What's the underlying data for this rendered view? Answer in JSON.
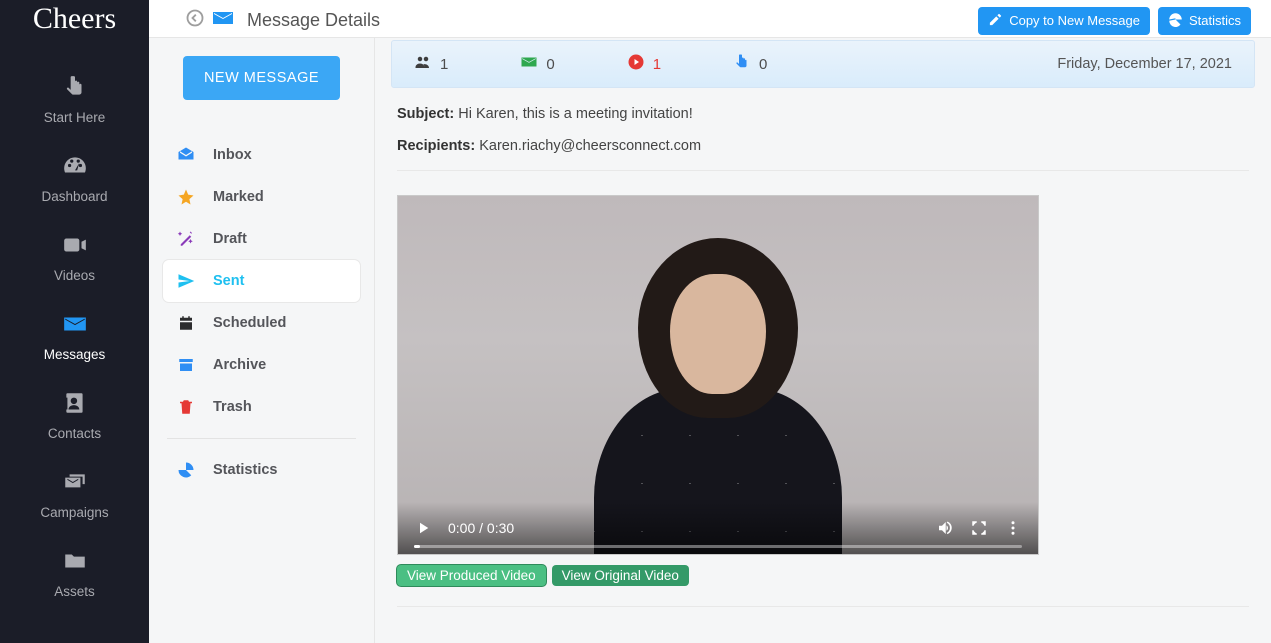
{
  "brand": "Cheers",
  "nav": {
    "items": [
      {
        "label": "Start Here"
      },
      {
        "label": "Dashboard"
      },
      {
        "label": "Videos"
      },
      {
        "label": "Messages"
      },
      {
        "label": "Contacts"
      },
      {
        "label": "Campaigns"
      },
      {
        "label": "Assets"
      }
    ]
  },
  "header": {
    "title": "Message Details",
    "copy_label": "Copy to New Message",
    "stats_label": "Statistics"
  },
  "compose": {
    "new_message_label": "NEW MESSAGE"
  },
  "folders": {
    "items": [
      {
        "label": "Inbox"
      },
      {
        "label": "Marked"
      },
      {
        "label": "Draft"
      },
      {
        "label": "Sent"
      },
      {
        "label": "Scheduled"
      },
      {
        "label": "Archive"
      },
      {
        "label": "Trash"
      }
    ],
    "statistics_label": "Statistics"
  },
  "stats": {
    "recipients": "1",
    "opens": "0",
    "plays": "1",
    "clicks": "0",
    "date": "Friday, December 17, 2021"
  },
  "message": {
    "subject_label": "Subject:",
    "subject": "Hi Karen, this is a meeting invitation!",
    "recipients_label": "Recipients:",
    "recipients": "Karen.riachy@cheersconnect.com"
  },
  "video": {
    "time_display": "0:00 / 0:30",
    "view_produced_label": "View Produced Video",
    "view_original_label": "View Original Video"
  }
}
